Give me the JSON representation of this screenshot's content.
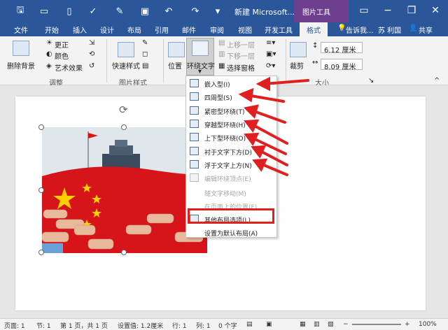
{
  "title_bar": {
    "document_title": "新建 Microsoft...",
    "context_tools": "图片工具"
  },
  "tabs": [
    "文件",
    "开始",
    "插入",
    "设计",
    "布局",
    "引用",
    "邮件",
    "审阅",
    "视图",
    "开发工具",
    "格式"
  ],
  "tell_me": "告诉我...",
  "user": "苏 利国",
  "share": "共享",
  "ribbon": {
    "remove_bg": "删除背景",
    "corrections": "更正",
    "color": "颜色",
    "artistic": "艺术效果",
    "adjust_label": "调整",
    "quick_styles": "快速样式",
    "picture_styles_label": "图片样式",
    "position": "位置",
    "wrap_text": "环绕文字",
    "bring_forward": "上移一层",
    "send_backward": "下移一层",
    "selection_pane": "选择窗格",
    "crop": "裁剪",
    "height": "6.12 厘米",
    "width": "8.09 厘米",
    "size_label": "大小"
  },
  "wrap_menu": {
    "items": [
      {
        "label": "嵌入型(I)",
        "enabled": true
      },
      {
        "label": "四周型(S)",
        "enabled": true
      },
      {
        "label": "紧密型环绕(T)",
        "enabled": true
      },
      {
        "label": "穿越型环绕(H)",
        "enabled": true
      },
      {
        "label": "上下型环绕(O)",
        "enabled": true
      },
      {
        "label": "衬于文字下方(D)",
        "enabled": true
      },
      {
        "label": "浮于文字上方(N)",
        "enabled": true
      },
      {
        "label": "编辑环绕顶点(E)",
        "enabled": false
      },
      {
        "label": "随文字移动(M)",
        "enabled": false
      },
      {
        "label": "在页面上的位置(F)",
        "enabled": false
      },
      {
        "label": "其他布局选项(L)...",
        "enabled": true
      },
      {
        "label": "设置为默认布局(A)",
        "enabled": true
      }
    ]
  },
  "status": {
    "page": "页面: 1",
    "section": "节: 1",
    "page_of": "第 1 页，共 1 页",
    "setting": "设置值: 1.2厘米",
    "line": "行: 1",
    "column": "列: 1",
    "chars": "0 个字",
    "zoom": "100%"
  },
  "accent_colors": {
    "titlebar": "#2b579a",
    "context": "#6d3f8e",
    "arrow": "#e02020"
  }
}
